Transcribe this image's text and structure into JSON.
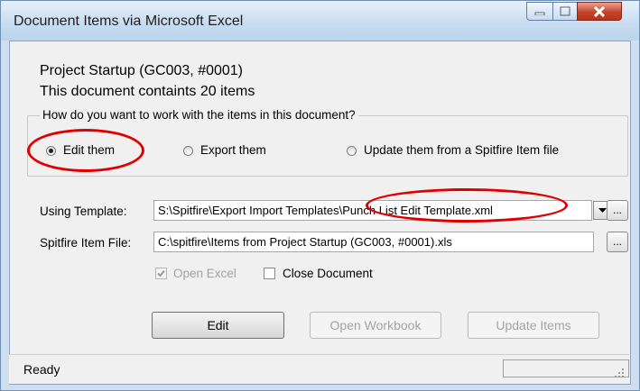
{
  "window": {
    "title": "Document Items via Microsoft Excel",
    "buttons": {
      "minimize": "minimize-icon",
      "maximize": "maximize-icon",
      "close": "close-icon"
    }
  },
  "info": {
    "line1": "Project Startup (GC003, #0001)",
    "line2": "This document containts 20 items"
  },
  "mode_group": {
    "legend": "How do you want to work with the items in this document?",
    "options": [
      {
        "label": "Edit them",
        "selected": true
      },
      {
        "label": "Export them",
        "selected": false
      },
      {
        "label": "Update them from a Spitfire Item file",
        "selected": false
      }
    ]
  },
  "template": {
    "label": "Using Template:",
    "path_prefix": "S:\\Spitfire\\Export Import Templates\\",
    "file_name": "Punch List Edit Template.xml",
    "browse_label": "..."
  },
  "item_file": {
    "label": "Spitfire Item File:",
    "value": "C:\\spitfire\\Items from Project Startup (GC003, #0001).xls",
    "browse_label": "..."
  },
  "options": {
    "open_excel": {
      "label": "Open Excel",
      "checked": true,
      "enabled": false
    },
    "close_document": {
      "label": "Close Document",
      "checked": false,
      "enabled": true
    }
  },
  "actions": {
    "edit": "Edit",
    "open_workbook": "Open Workbook",
    "update_items": "Update Items"
  },
  "status": {
    "text": "Ready"
  },
  "colors": {
    "highlight_ring": "#e00000",
    "window_frame": "#cfdff0",
    "close_button": "#c4442c"
  }
}
